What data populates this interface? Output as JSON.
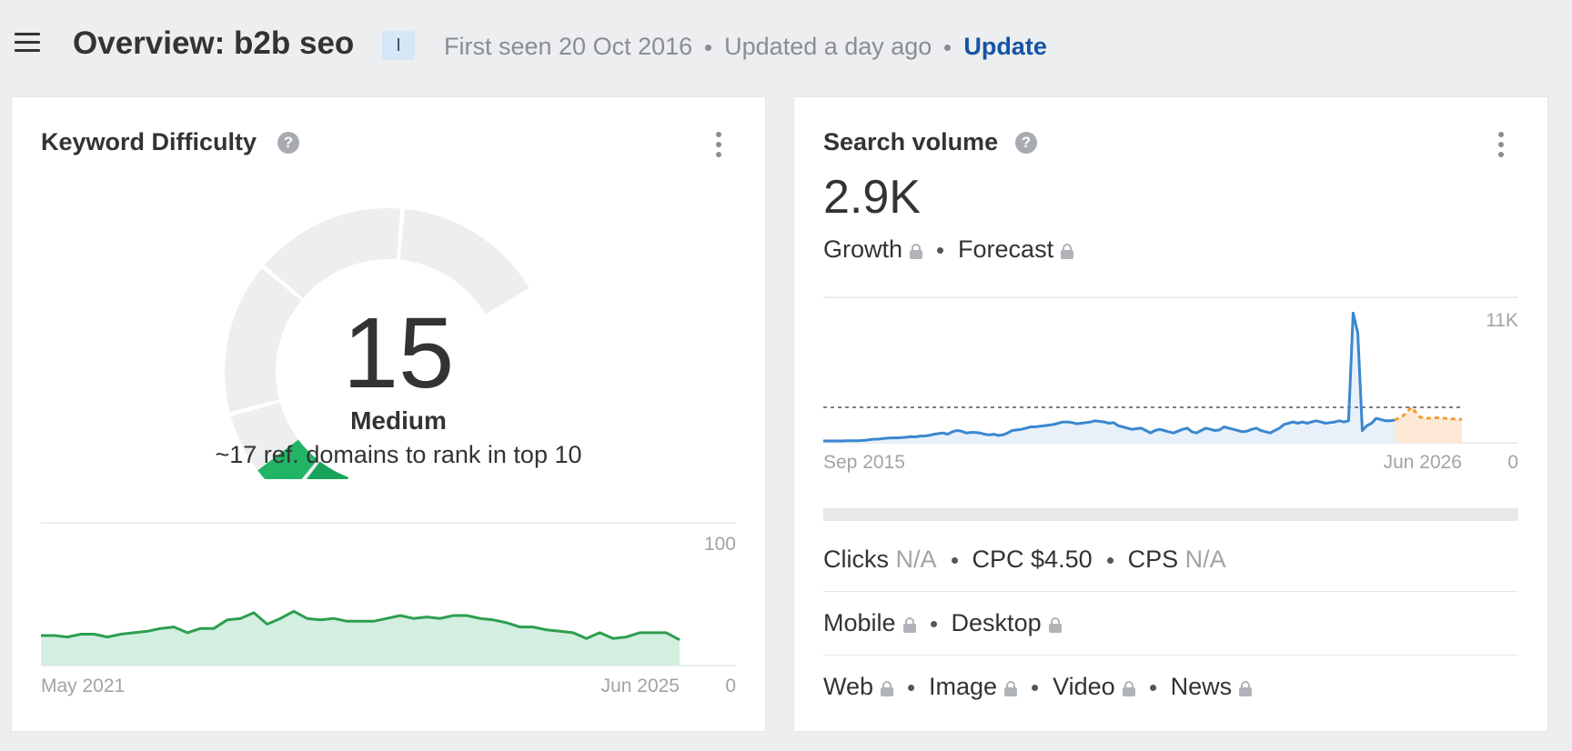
{
  "header": {
    "title": "Overview: b2b seo",
    "intent_badge": "I",
    "first_seen": "First seen 20 Oct 2016",
    "updated": "Updated a day ago",
    "update_link": "Update"
  },
  "keyword_difficulty": {
    "title": "Keyword Difficulty",
    "value": "15",
    "level": "Medium",
    "caption": "~17 ref. domains to rank in top 10",
    "gauge_fill_percent": 15,
    "gauge_color": "#1aa35a"
  },
  "search_volume": {
    "title": "Search volume",
    "value": "2.9K",
    "growth_label": "Growth",
    "forecast_label": "Forecast",
    "metrics": {
      "clicks_label": "Clicks",
      "clicks_value": "N/A",
      "cpc_label": "CPC $4.50",
      "cps_label": "CPS",
      "cps_value": "N/A"
    },
    "devices": {
      "mobile": "Mobile",
      "desktop": "Desktop"
    },
    "types": {
      "web": "Web",
      "image": "Image",
      "video": "Video",
      "news": "News"
    }
  },
  "colors": {
    "kd_line": "#2e9e4f",
    "kd_fill": "#d3efe0",
    "sv_line": "#3b87cf",
    "sv_fill": "#e8f1fa",
    "forecast_line": "#f0a030",
    "forecast_fill": "#fde9d6",
    "update_link": "#1554a3"
  },
  "chart_data": [
    {
      "type": "area",
      "xlabels": [
        "May 2021",
        "Jun 2025"
      ],
      "ymax_label": "100",
      "ymin_label": "0",
      "ylim": [
        0,
        100
      ],
      "values": [
        21,
        21,
        20,
        22,
        22,
        20,
        22,
        23,
        24,
        26,
        27,
        23,
        26,
        26,
        32,
        33,
        37,
        29,
        33,
        38,
        33,
        32,
        33,
        31,
        31,
        31,
        33,
        35,
        33,
        34,
        33,
        35,
        35,
        33,
        32,
        30,
        27,
        27,
        25,
        24,
        23,
        19,
        23,
        19,
        20,
        23,
        23,
        23,
        18
      ]
    },
    {
      "type": "line",
      "xlabels": [
        "Sep 2015",
        "Jun 2026"
      ],
      "ymax_label": "11K",
      "ymin_label": "0",
      "ylim": [
        0,
        11000
      ],
      "reference_line": 2900,
      "values": [
        150,
        150,
        150,
        150,
        150,
        160,
        170,
        170,
        180,
        200,
        250,
        300,
        300,
        350,
        380,
        400,
        400,
        420,
        450,
        500,
        480,
        550,
        560,
        600,
        700,
        750,
        800,
        700,
        900,
        1000,
        950,
        800,
        850,
        850,
        800,
        700,
        650,
        700,
        600,
        650,
        800,
        1000,
        1050,
        1100,
        1200,
        1300,
        1300,
        1350,
        1400,
        1450,
        1500,
        1600,
        1700,
        1700,
        1650,
        1550,
        1600,
        1650,
        1700,
        1800,
        1750,
        1700,
        1600,
        1650,
        1400,
        1300,
        1200,
        1100,
        1150,
        1200,
        1000,
        800,
        1000,
        1100,
        1000,
        900,
        800,
        950,
        1100,
        1200,
        900,
        800,
        1000,
        1200,
        1100,
        1000,
        1050,
        1300,
        1200,
        1100,
        1000,
        900,
        950,
        1100,
        1200,
        1000,
        900,
        800,
        1000,
        1200,
        1500,
        1600,
        1700,
        1600,
        1700,
        1600,
        1700,
        1800,
        1700,
        1600,
        1650,
        1700,
        1800,
        1700,
        1800,
        10600,
        9000,
        1000,
        1400,
        1600,
        2000,
        1900,
        1800,
        1800,
        1850
      ],
      "forecast": [
        1850,
        2200,
        2900,
        2100,
        2000,
        2050,
        2000,
        1950,
        1900
      ]
    }
  ]
}
